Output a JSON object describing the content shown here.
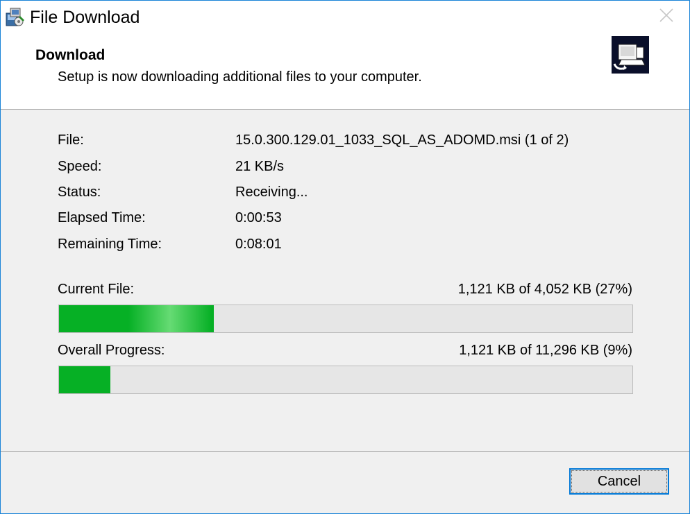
{
  "window": {
    "title": "File Download",
    "accent_color": "#1883d7"
  },
  "header": {
    "title": "Download",
    "subtitle": "Setup is now downloading additional files to your computer."
  },
  "info": [
    {
      "label": "File:",
      "value": "15.0.300.129.01_1033_SQL_AS_ADOMD.msi (1 of 2)"
    },
    {
      "label": "Speed:",
      "value": "21 KB/s"
    },
    {
      "label": "Status:",
      "value": "Receiving..."
    },
    {
      "label": "Elapsed Time:",
      "value": "0:00:53"
    },
    {
      "label": "Remaining Time:",
      "value": "0:08:01"
    }
  ],
  "current_file": {
    "label": "Current File:",
    "text": "1,121 KB of 4,052 KB (27%)",
    "percent": 27
  },
  "overall": {
    "label": "Overall Progress:",
    "text": "1,121 KB of 11,296 KB (9%)",
    "percent": 9
  },
  "progress_color": "#06b025",
  "buttons": {
    "cancel_label": "Cancel"
  },
  "icons": {
    "app": "installer-icon",
    "header": "computer-download-icon",
    "close": "close-icon"
  }
}
